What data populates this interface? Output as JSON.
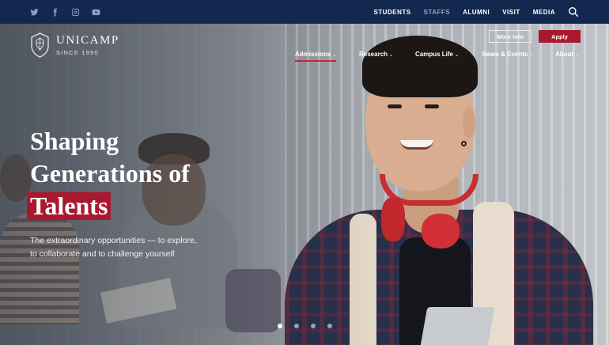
{
  "topbar": {
    "social": [
      "twitter-icon",
      "facebook-icon",
      "instagram-icon",
      "youtube-icon"
    ],
    "links": [
      {
        "label": "STUDENTS",
        "muted": false
      },
      {
        "label": "STAFFS",
        "muted": true
      },
      {
        "label": "ALUMNI",
        "muted": false
      },
      {
        "label": "VISIT",
        "muted": false
      },
      {
        "label": "MEDIA",
        "muted": false
      }
    ]
  },
  "brand": {
    "name": "UNICAMP",
    "tagline": "SINCE 1990"
  },
  "header_buttons": {
    "more_info": "More info",
    "apply": "Apply"
  },
  "mainnav": [
    {
      "label": "Admissions",
      "active": true
    },
    {
      "label": "Research",
      "active": false
    },
    {
      "label": "Campus Life",
      "active": false
    },
    {
      "label": "News & Events",
      "active": false
    },
    {
      "label": "About",
      "active": false
    }
  ],
  "hero": {
    "headline_line1": "Shaping",
    "headline_line2": "Generations of",
    "headline_highlight": "Talents",
    "subtitle_line1": "The extraordinary opportunities — to explore,",
    "subtitle_line2": "to collaborate and to challenge yourself"
  },
  "carousel": {
    "slides": 4,
    "active_index": 0
  },
  "colors": {
    "navy": "#13284f",
    "accent": "#a8192f"
  }
}
